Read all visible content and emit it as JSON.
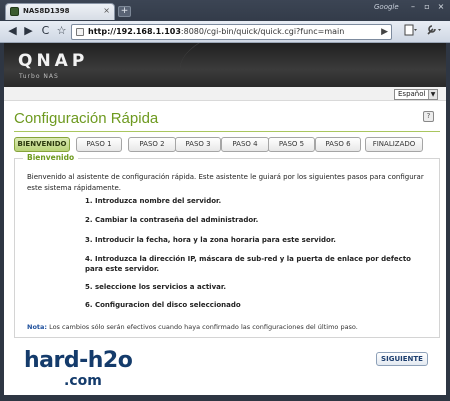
{
  "browser": {
    "tab_title": "NAS8D1398",
    "tab_close": "×",
    "new_tab": "+",
    "google_label": "Google",
    "window_controls": [
      "–",
      "▫",
      "×"
    ],
    "nav": {
      "back": "◀",
      "forward": "▶",
      "reload": "C",
      "star": "☆"
    },
    "url": {
      "host": "http://192.168.1.103",
      "path": ":8080/cgi-bin/quick/quick.cgi?func=main"
    },
    "url_go": "▶",
    "page_menu_icon": "page-icon",
    "tools_menu_icon": "wrench-icon"
  },
  "header": {
    "logo": "QNAP",
    "tagline": "Turbo NAS"
  },
  "language": {
    "selected": "Español"
  },
  "page": {
    "title": "Configuración Rápida",
    "help": "?"
  },
  "steps": [
    "BIENVENIDO",
    "PASO 1",
    "PASO 2",
    "PASO 3",
    "PASO 4",
    "PASO 5",
    "PASO 6",
    "FINALIZADO"
  ],
  "panel": {
    "legend": "Bienvenido",
    "intro": "Bienvenido al asistente de configuración rápida. Este asistente le guiará por los siguientes pasos para configurar este sistema rápidamente.",
    "items": [
      "1. Introduzca nombre del servidor.",
      "2. Cambiar la contraseña del administrador.",
      "3. Introducir la fecha, hora y la zona horaria para este servidor.",
      "4. Introduzca la dirección IP, máscara de sub-red y la puerta de enlace por defecto para este servidor.",
      "5. seleccione los servicios a activar.",
      "6. Configuracion del disco seleccionado"
    ],
    "note_label": "Nota:",
    "note_text": " Los cambios sólo serán efectivos cuando haya confirmado las configuraciones del último paso."
  },
  "next_button": "SIGUIENTE",
  "watermark": {
    "main": "hard-h2o",
    "sub": ".com"
  }
}
